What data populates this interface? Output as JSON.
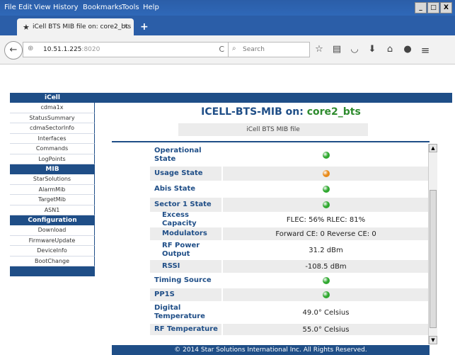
{
  "browser": {
    "menu": [
      "File",
      "Edit",
      "View",
      "History",
      "Bookmarks",
      "Tools",
      "Help"
    ],
    "window_buttons": [
      "_",
      "□",
      "X"
    ],
    "tab_title": "iCell BTS MIB file on: core2_bts",
    "tab_close": "×",
    "new_tab": "+",
    "url_host": "10.51.1.225",
    "url_port": ":8020",
    "search_placeholder": "Search",
    "reload": "C"
  },
  "sidebar": {
    "groups": [
      {
        "title": "iCell",
        "items": [
          "cdma1x",
          "StatusSummary",
          "cdmaSectorInfo",
          "Interfaces",
          "Commands",
          "LogPoints"
        ]
      },
      {
        "title": "MIB",
        "items": [
          "StarSolutions",
          "AlarmMib",
          "TargetMib",
          "ASN1"
        ]
      },
      {
        "title": "Configuration",
        "items": [
          "Download",
          "FirmwareUpdate",
          "DeviceInfo",
          "BootChange"
        ]
      }
    ]
  },
  "main": {
    "title_prefix": "ICELL-BTS-MIB on: ",
    "device_name": "core2_bts",
    "subtitle": "iCell BTS MIB file",
    "rows": [
      {
        "label": "Operational State",
        "status": "green",
        "indent": false
      },
      {
        "label": "Usage State",
        "status": "orange",
        "indent": false
      },
      {
        "label": "Abis State",
        "status": "green",
        "indent": false
      },
      {
        "label": "Sector 1 State",
        "status": "green",
        "indent": false
      },
      {
        "label": "Excess Capacity",
        "value": "FLEC: 56% RLEC: 81%",
        "indent": true
      },
      {
        "label": "Modulators",
        "value": "Forward CE: 0 Reverse CE: 0",
        "indent": true
      },
      {
        "label": "RF Power Output",
        "value": "31.2 dBm",
        "indent": true
      },
      {
        "label": "RSSI",
        "value": "-108.5 dBm",
        "indent": true
      },
      {
        "label": "Timing Source",
        "status": "green",
        "indent": false
      },
      {
        "label": "PP1S",
        "status": "green",
        "indent": false
      },
      {
        "label": "Digital Temperature",
        "value": "49.0° Celsius",
        "indent": false
      },
      {
        "label": "RF Temperature",
        "value": "55.0° Celsius",
        "indent": false
      }
    ]
  },
  "footer": {
    "text": "© 2014 Star Solutions International Inc. All Rights Reserved."
  },
  "colors": {
    "navy": "#1f4e87",
    "device_green": "#2e8b2e",
    "status_green": "#2fa82f",
    "status_orange": "#e88a1a"
  }
}
